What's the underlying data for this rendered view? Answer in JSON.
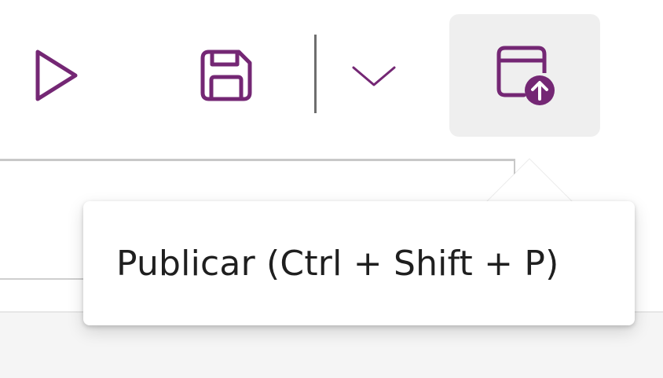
{
  "toolbar": {
    "icons": {
      "play": "play-icon",
      "save": "save-icon",
      "dropdown": "chevron-down-icon",
      "publish": "publish-icon"
    },
    "accent_color": "#742774",
    "hover_background": "#efefef"
  },
  "tooltip": {
    "text": "Publicar (Ctrl + Shift + P)"
  }
}
